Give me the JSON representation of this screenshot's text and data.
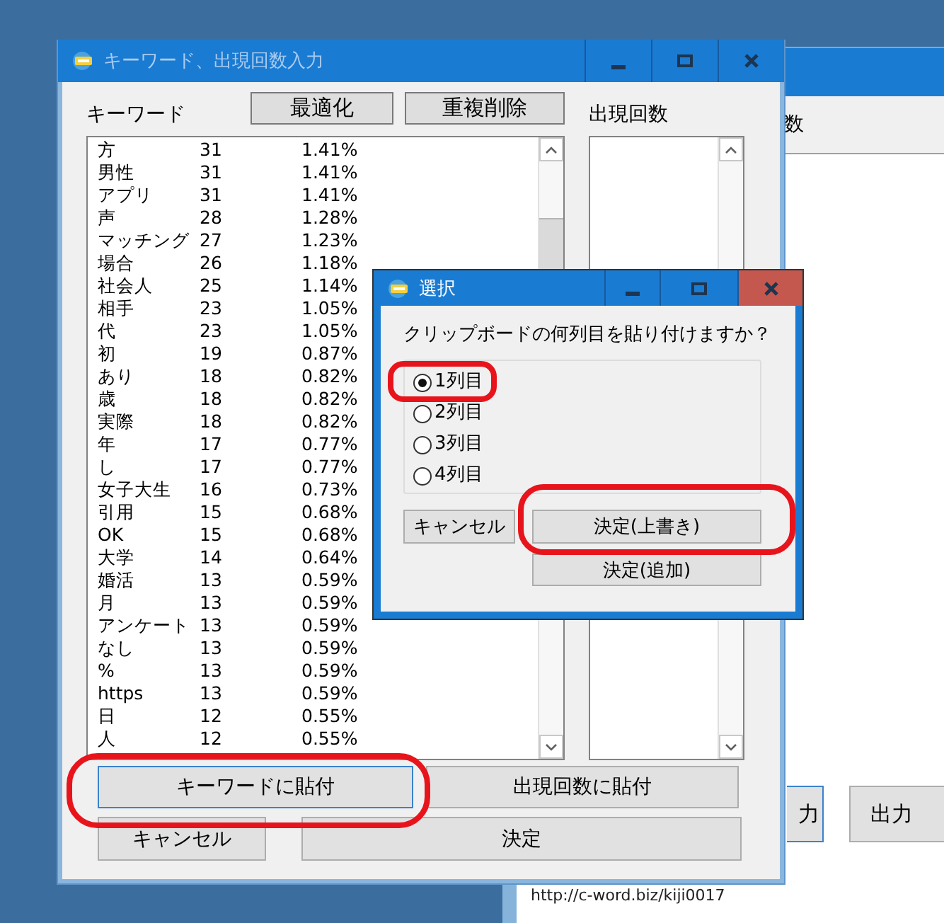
{
  "background_window": {
    "column_label": "数",
    "buttons": [
      {
        "label": "力",
        "focused": true
      },
      {
        "label": "出力",
        "focused": false
      }
    ],
    "link": "http://c-word.biz/kiji0017"
  },
  "main_window": {
    "title": "キーワード、出現回数入力",
    "keyword_label": "キーワード",
    "toolbar_buttons": [
      "最適化",
      "重複削除"
    ],
    "count_label": "出現回数",
    "keyword_rows": [
      {
        "keyword": "方",
        "count": "31",
        "ratio": "1.41%"
      },
      {
        "keyword": "男性",
        "count": "31",
        "ratio": "1.41%"
      },
      {
        "keyword": "アプリ",
        "count": "31",
        "ratio": "1.41%"
      },
      {
        "keyword": "声",
        "count": "28",
        "ratio": "1.28%"
      },
      {
        "keyword": "マッチング",
        "count": "27",
        "ratio": "1.23%"
      },
      {
        "keyword": "場合",
        "count": "26",
        "ratio": "1.18%"
      },
      {
        "keyword": "社会人",
        "count": "25",
        "ratio": "1.14%"
      },
      {
        "keyword": "相手",
        "count": "23",
        "ratio": "1.05%"
      },
      {
        "keyword": "代",
        "count": "23",
        "ratio": "1.05%"
      },
      {
        "keyword": "初",
        "count": "19",
        "ratio": "0.87%"
      },
      {
        "keyword": "あり",
        "count": "18",
        "ratio": "0.82%"
      },
      {
        "keyword": "歳",
        "count": "18",
        "ratio": "0.82%"
      },
      {
        "keyword": "実際",
        "count": "18",
        "ratio": "0.82%"
      },
      {
        "keyword": "年",
        "count": "17",
        "ratio": "0.77%"
      },
      {
        "keyword": "し",
        "count": "17",
        "ratio": "0.77%"
      },
      {
        "keyword": "女子大生",
        "count": "16",
        "ratio": "0.73%"
      },
      {
        "keyword": "引用",
        "count": "15",
        "ratio": "0.68%"
      },
      {
        "keyword": "OK",
        "count": "15",
        "ratio": "0.68%"
      },
      {
        "keyword": "大学",
        "count": "14",
        "ratio": "0.64%"
      },
      {
        "keyword": "婚活",
        "count": "13",
        "ratio": "0.59%"
      },
      {
        "keyword": "月",
        "count": "13",
        "ratio": "0.59%"
      },
      {
        "keyword": "アンケート",
        "count": "13",
        "ratio": "0.59%"
      },
      {
        "keyword": "なし",
        "count": "13",
        "ratio": "0.59%"
      },
      {
        "keyword": "%",
        "count": "13",
        "ratio": "0.59%"
      },
      {
        "keyword": "https",
        "count": "13",
        "ratio": "0.59%"
      },
      {
        "keyword": "日",
        "count": "12",
        "ratio": "0.55%"
      },
      {
        "keyword": "人",
        "count": "12",
        "ratio": "0.55%"
      }
    ],
    "paste_buttons": [
      {
        "label": "キーワードに貼付",
        "focused": true
      },
      {
        "label": "出現回数に貼付",
        "focused": false
      }
    ],
    "cancel_button": "キャンセル",
    "ok_button": "決定"
  },
  "dialog": {
    "title": "選択",
    "prompt": "クリップボードの何列目を貼り付けますか？",
    "options": [
      {
        "label": "1列目",
        "selected": true
      },
      {
        "label": "2列目",
        "selected": false
      },
      {
        "label": "3列目",
        "selected": false
      },
      {
        "label": "4列目",
        "selected": false
      }
    ],
    "cancel_button": "キャンセル",
    "overwrite_button": "決定(上書き)",
    "append_button": "決定(追加)"
  }
}
